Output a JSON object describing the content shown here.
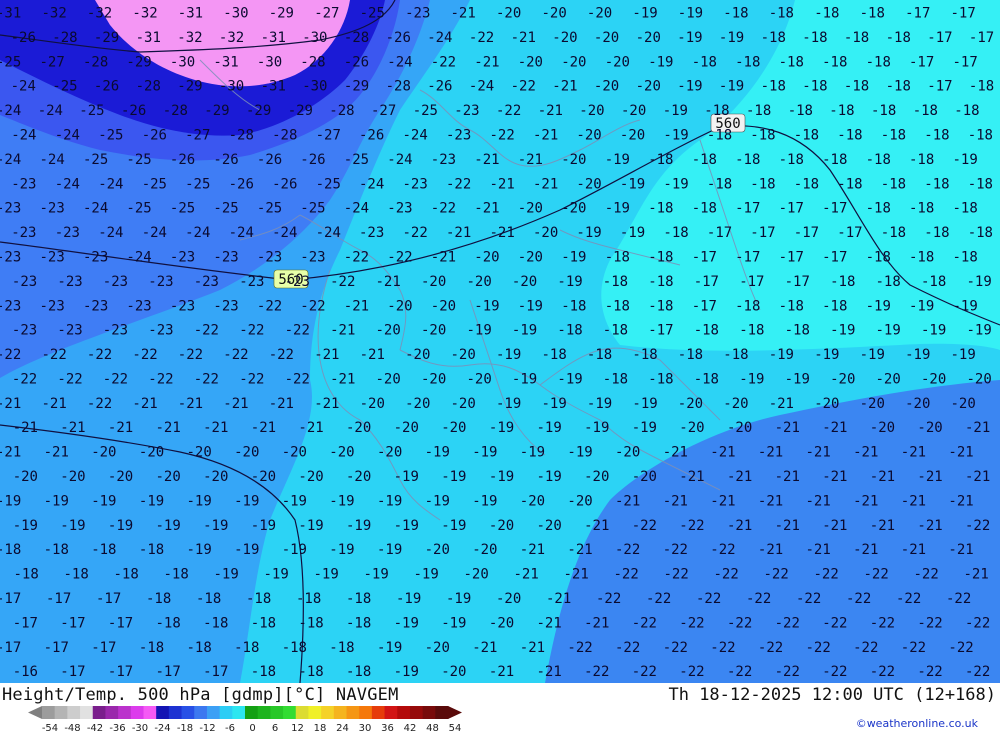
{
  "map": {
    "title": "Height/Temp. 500 hPa [gdmp][°C] NAVGEM",
    "datetime": "Th 18-12-2025 12:00 UTC (12+168)",
    "credit": "©weatheronline.co.uk",
    "height_labels": [
      "560",
      "560"
    ],
    "colors": {
      "t_lt_30": "#1b1bd6",
      "t_lt_32": "#f496f4",
      "t_28_30": "#3b57f0",
      "t_24_28": "#3f7df5",
      "t_20_24": "#35a6f7",
      "t_18_20": "#2cd3f5",
      "t_gt_18": "#35f0f5",
      "t_warm_se": "#3b86f2",
      "contour": "#101040",
      "border": "#7c8fb8"
    },
    "temperature_rows": [
      {
        "row": 0,
        "values": [
          "-31",
          "-32",
          "-32",
          "-32",
          "-31",
          "-30",
          "-29",
          "-27",
          "-25",
          "-23",
          "-21",
          "-20",
          "-20",
          "-20",
          "-19",
          "-19",
          "-18",
          "-18",
          "-18",
          "-18",
          "-17",
          "-17"
        ]
      },
      {
        "row": 1,
        "values": [
          "-26",
          "-28",
          "-29",
          "-31",
          "-32",
          "-32",
          "-31",
          "-30",
          "-28",
          "-26",
          "-24",
          "-22",
          "-21",
          "-20",
          "-20",
          "-20",
          "-19",
          "-19",
          "-18",
          "-18",
          "-18",
          "-18",
          "-17",
          "-17"
        ]
      },
      {
        "row": 2,
        "values": [
          "-25",
          "-27",
          "-28",
          "-29",
          "-30",
          "-31",
          "-30",
          "-28",
          "-26",
          "-24",
          "-22",
          "-21",
          "-20",
          "-20",
          "-20",
          "-19",
          "-18",
          "-18",
          "-18",
          "-18",
          "-18",
          "-17",
          "-17"
        ]
      },
      {
        "row": 3,
        "values": [
          "-24",
          "-25",
          "-26",
          "-28",
          "-29",
          "-30",
          "-31",
          "-30",
          "-29",
          "-28",
          "-26",
          "-24",
          "-22",
          "-21",
          "-20",
          "-20",
          "-19",
          "-19",
          "-18",
          "-18",
          "-18",
          "-18",
          "-17",
          "-18"
        ]
      },
      {
        "row": 4,
        "values": [
          "-24",
          "-24",
          "-25",
          "-26",
          "-28",
          "-29",
          "-29",
          "-29",
          "-28",
          "-27",
          "-25",
          "-23",
          "-22",
          "-21",
          "-20",
          "-20",
          "-19",
          "-18",
          "-18",
          "-18",
          "-18",
          "-18",
          "-18",
          "-18"
        ]
      },
      {
        "row": 5,
        "values": [
          "-24",
          "-24",
          "-25",
          "-26",
          "-27",
          "-28",
          "-28",
          "-27",
          "-26",
          "-24",
          "-23",
          "-22",
          "-21",
          "-20",
          "-20",
          "-19",
          "-18",
          "-18",
          "-18",
          "-18",
          "-18",
          "-18",
          "-18"
        ]
      },
      {
        "row": 6,
        "values": [
          "-24",
          "-24",
          "-25",
          "-25",
          "-26",
          "-26",
          "-26",
          "-26",
          "-25",
          "-24",
          "-23",
          "-21",
          "-21",
          "-20",
          "-19",
          "-18",
          "-18",
          "-18",
          "-18",
          "-18",
          "-18",
          "-18",
          "-19"
        ]
      },
      {
        "row": 7,
        "values": [
          "-23",
          "-24",
          "-24",
          "-25",
          "-25",
          "-26",
          "-26",
          "-25",
          "-24",
          "-23",
          "-22",
          "-21",
          "-21",
          "-20",
          "-19",
          "-19",
          "-18",
          "-18",
          "-18",
          "-18",
          "-18",
          "-18",
          "-18"
        ]
      },
      {
        "row": 8,
        "values": [
          "-23",
          "-23",
          "-24",
          "-25",
          "-25",
          "-25",
          "-25",
          "-25",
          "-24",
          "-23",
          "-22",
          "-21",
          "-20",
          "-20",
          "-19",
          "-18",
          "-18",
          "-17",
          "-17",
          "-17",
          "-18",
          "-18",
          "-18"
        ]
      },
      {
        "row": 9,
        "values": [
          "-23",
          "-23",
          "-24",
          "-24",
          "-24",
          "-24",
          "-24",
          "-24",
          "-23",
          "-22",
          "-21",
          "-21",
          "-20",
          "-19",
          "-19",
          "-18",
          "-17",
          "-17",
          "-17",
          "-17",
          "-18",
          "-18",
          "-18"
        ]
      },
      {
        "row": 10,
        "values": [
          "-23",
          "-23",
          "-23",
          "-24",
          "-23",
          "-23",
          "-23",
          "-23",
          "-22",
          "-22",
          "-21",
          "-20",
          "-20",
          "-19",
          "-18",
          "-18",
          "-17",
          "-17",
          "-17",
          "-17",
          "-18",
          "-18",
          "-18"
        ]
      },
      {
        "row": 11,
        "values": [
          "-23",
          "-23",
          "-23",
          "-23",
          "-23",
          "-23",
          "-23",
          "-22",
          "-21",
          "-20",
          "-20",
          "-20",
          "-19",
          "-18",
          "-18",
          "-17",
          "-17",
          "-17",
          "-18",
          "-18",
          "-18",
          "-19"
        ]
      },
      {
        "row": 12,
        "values": [
          "-23",
          "-23",
          "-23",
          "-23",
          "-23",
          "-23",
          "-22",
          "-22",
          "-21",
          "-20",
          "-20",
          "-19",
          "-19",
          "-18",
          "-18",
          "-18",
          "-17",
          "-18",
          "-18",
          "-18",
          "-19",
          "-19",
          "-19"
        ]
      },
      {
        "row": 13,
        "values": [
          "-23",
          "-23",
          "-23",
          "-23",
          "-22",
          "-22",
          "-22",
          "-21",
          "-20",
          "-20",
          "-19",
          "-19",
          "-18",
          "-18",
          "-17",
          "-18",
          "-18",
          "-18",
          "-19",
          "-19",
          "-19",
          "-19"
        ]
      },
      {
        "row": 14,
        "values": [
          "-22",
          "-22",
          "-22",
          "-22",
          "-22",
          "-22",
          "-22",
          "-21",
          "-21",
          "-20",
          "-20",
          "-19",
          "-18",
          "-18",
          "-18",
          "-18",
          "-18",
          "-19",
          "-19",
          "-19",
          "-19",
          "-19"
        ]
      },
      {
        "row": 15,
        "values": [
          "-22",
          "-22",
          "-22",
          "-22",
          "-22",
          "-22",
          "-22",
          "-21",
          "-20",
          "-20",
          "-20",
          "-19",
          "-19",
          "-18",
          "-18",
          "-18",
          "-19",
          "-19",
          "-20",
          "-20",
          "-20",
          "-20"
        ]
      },
      {
        "row": 16,
        "values": [
          "-21",
          "-21",
          "-22",
          "-21",
          "-21",
          "-21",
          "-21",
          "-21",
          "-20",
          "-20",
          "-20",
          "-19",
          "-19",
          "-19",
          "-19",
          "-20",
          "-20",
          "-21",
          "-20",
          "-20",
          "-20",
          "-20"
        ]
      },
      {
        "row": 17,
        "values": [
          "-21",
          "-21",
          "-21",
          "-21",
          "-21",
          "-21",
          "-21",
          "-20",
          "-20",
          "-20",
          "-19",
          "-19",
          "-19",
          "-19",
          "-20",
          "-20",
          "-21",
          "-21",
          "-20",
          "-20",
          "-21"
        ]
      },
      {
        "row": 18,
        "values": [
          "-21",
          "-21",
          "-20",
          "-20",
          "-20",
          "-20",
          "-20",
          "-20",
          "-20",
          "-19",
          "-19",
          "-19",
          "-19",
          "-20",
          "-21",
          "-21",
          "-21",
          "-21",
          "-21",
          "-21",
          "-21"
        ]
      },
      {
        "row": 19,
        "values": [
          "-20",
          "-20",
          "-20",
          "-20",
          "-20",
          "-20",
          "-20",
          "-20",
          "-19",
          "-19",
          "-19",
          "-19",
          "-20",
          "-20",
          "-21",
          "-21",
          "-21",
          "-21",
          "-21",
          "-21",
          "-21"
        ]
      },
      {
        "row": 20,
        "values": [
          "-19",
          "-19",
          "-19",
          "-19",
          "-19",
          "-19",
          "-19",
          "-19",
          "-19",
          "-19",
          "-19",
          "-20",
          "-20",
          "-21",
          "-21",
          "-21",
          "-21",
          "-21",
          "-21",
          "-21",
          "-21"
        ]
      },
      {
        "row": 21,
        "values": [
          "-19",
          "-19",
          "-19",
          "-19",
          "-19",
          "-19",
          "-19",
          "-19",
          "-19",
          "-19",
          "-20",
          "-20",
          "-21",
          "-22",
          "-22",
          "-21",
          "-21",
          "-21",
          "-21",
          "-21",
          "-22"
        ]
      },
      {
        "row": 22,
        "values": [
          "-18",
          "-18",
          "-18",
          "-18",
          "-19",
          "-19",
          "-19",
          "-19",
          "-19",
          "-20",
          "-20",
          "-21",
          "-21",
          "-22",
          "-22",
          "-22",
          "-21",
          "-21",
          "-21",
          "-21",
          "-21"
        ]
      },
      {
        "row": 23,
        "values": [
          "-18",
          "-18",
          "-18",
          "-18",
          "-19",
          "-19",
          "-19",
          "-19",
          "-19",
          "-20",
          "-21",
          "-21",
          "-22",
          "-22",
          "-22",
          "-22",
          "-22",
          "-22",
          "-22",
          "-21"
        ]
      },
      {
        "row": 24,
        "values": [
          "-17",
          "-17",
          "-17",
          "-18",
          "-18",
          "-18",
          "-18",
          "-18",
          "-19",
          "-19",
          "-20",
          "-21",
          "-22",
          "-22",
          "-22",
          "-22",
          "-22",
          "-22",
          "-22",
          "-22"
        ]
      },
      {
        "row": 25,
        "values": [
          "-17",
          "-17",
          "-17",
          "-18",
          "-18",
          "-18",
          "-18",
          "-18",
          "-19",
          "-19",
          "-20",
          "-21",
          "-21",
          "-22",
          "-22",
          "-22",
          "-22",
          "-22",
          "-22",
          "-22",
          "-22"
        ]
      },
      {
        "row": 26,
        "values": [
          "-17",
          "-17",
          "-17",
          "-18",
          "-18",
          "-18",
          "-18",
          "-18",
          "-19",
          "-20",
          "-21",
          "-21",
          "-22",
          "-22",
          "-22",
          "-22",
          "-22",
          "-22",
          "-22",
          "-22",
          "-22"
        ]
      },
      {
        "row": 27,
        "values": [
          "-16",
          "-17",
          "-17",
          "-17",
          "-17",
          "-18",
          "-18",
          "-18",
          "-19",
          "-20",
          "-21",
          "-21",
          "-22",
          "-22",
          "-22",
          "-22",
          "-22",
          "-22",
          "-22",
          "-22",
          "-22"
        ]
      }
    ],
    "legend": {
      "tick_labels": [
        "-54",
        "-48",
        "-42",
        "-36",
        "-30",
        "-24",
        "-18",
        "-12",
        "-6",
        "0",
        "6",
        "12",
        "18",
        "24",
        "30",
        "36",
        "42",
        "48",
        "54"
      ],
      "swatches": [
        "#9c9c9c",
        "#b4b4b4",
        "#cdcdcd",
        "#e1e1e1",
        "#7a1e8c",
        "#9a28ac",
        "#bb32cc",
        "#dc3cec",
        "#f55af5",
        "#1414b4",
        "#1e32d2",
        "#2850e6",
        "#3c78f0",
        "#3ca0f5",
        "#2ccdf5",
        "#2ce6f0",
        "#14a014",
        "#1eb41e",
        "#28c828",
        "#32dc32",
        "#dcdc32",
        "#f0f028",
        "#f5d228",
        "#f5b41e",
        "#f59614",
        "#f5780a",
        "#e63c0a",
        "#d21414",
        "#b40a0a",
        "#960a0a",
        "#780a0a",
        "#5a0a0a"
      ]
    }
  }
}
